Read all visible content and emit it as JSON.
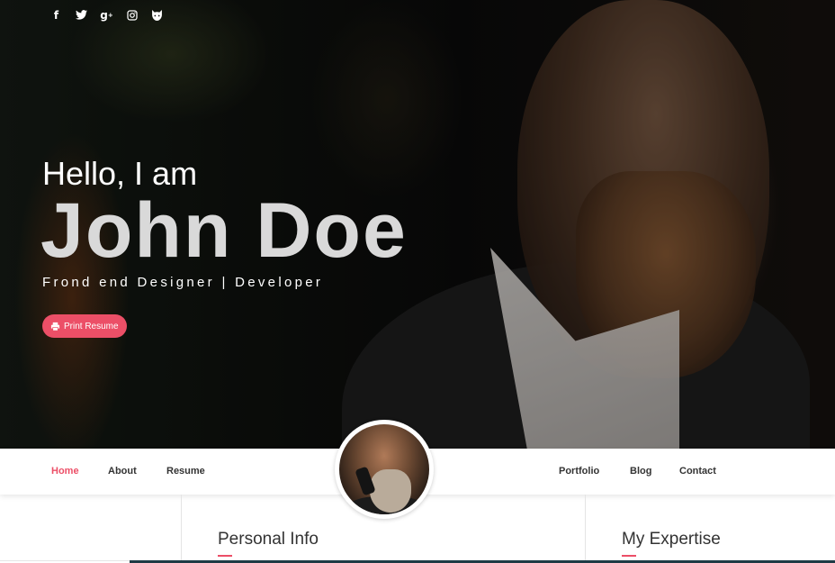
{
  "social": {
    "icons": [
      {
        "name": "facebook-icon",
        "glyph": "f"
      },
      {
        "name": "twitter-icon",
        "glyph": "🐦"
      },
      {
        "name": "google-plus-icon",
        "glyph": "g+"
      },
      {
        "name": "instagram-icon",
        "glyph": "◎"
      },
      {
        "name": "github-icon",
        "glyph": "🐱"
      }
    ]
  },
  "hero": {
    "greeting": "Hello, I am",
    "name": "John Doe",
    "tagline": "Frond end Designer | Developer",
    "button_label": "Print Resume",
    "button_icon": "printer-icon"
  },
  "nav": {
    "left": [
      "Home",
      "About",
      "Resume"
    ],
    "right": [
      "Portfolio",
      "Blog",
      "Contact"
    ],
    "active": "Home"
  },
  "sections": {
    "personal_info": "Personal Info",
    "my_expertise": "My Expertise"
  },
  "colors": {
    "accent": "#ec4f67",
    "text_dark": "#333333",
    "bottom_strip": "#1e3a45"
  }
}
